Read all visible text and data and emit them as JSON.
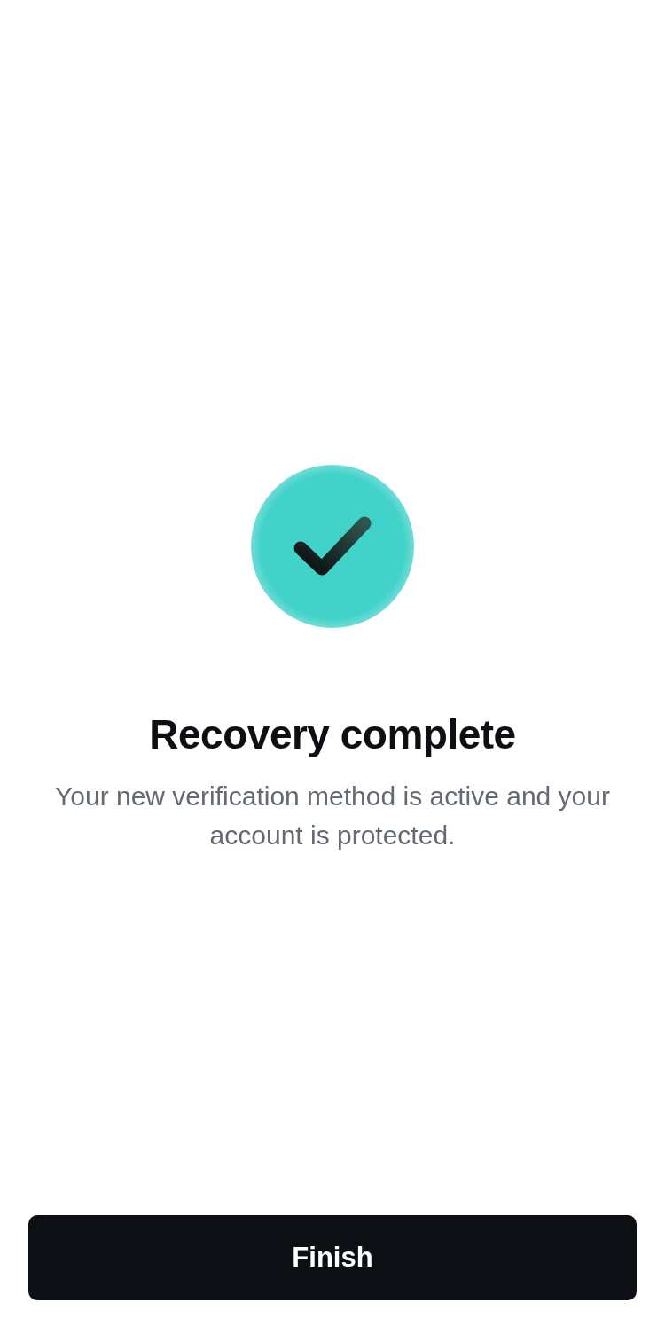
{
  "title": "Recovery complete",
  "message": "Your new verification method is active and your account is protected.",
  "buttons": [
    {
      "label": "Finish",
      "kind": "primary"
    }
  ]
}
